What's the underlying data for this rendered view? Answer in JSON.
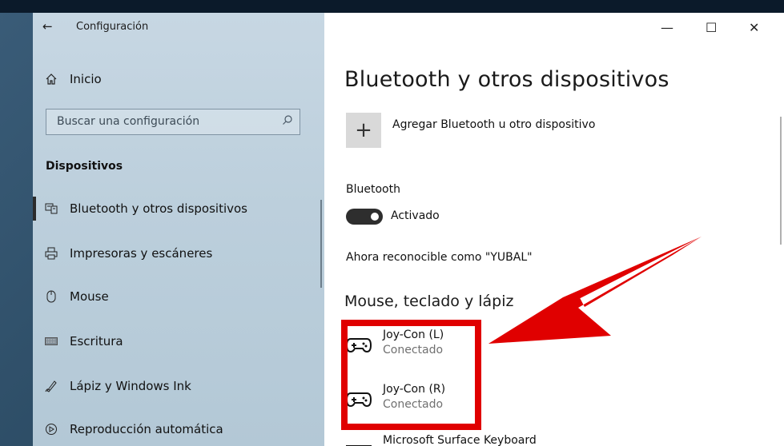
{
  "window": {
    "back_glyph": "←",
    "title": "Configuración",
    "controls": {
      "minimize": "—",
      "maximize": "☐",
      "close": "✕"
    }
  },
  "sidebar": {
    "home_label": "Inicio",
    "search_placeholder": "Buscar una configuración",
    "section_title": "Dispositivos",
    "items": [
      {
        "label": "Bluetooth y otros dispositivos",
        "icon": "bluetooth-devices-icon",
        "active": true
      },
      {
        "label": "Impresoras y escáneres",
        "icon": "printer-icon"
      },
      {
        "label": "Mouse",
        "icon": "mouse-icon"
      },
      {
        "label": "Escritura",
        "icon": "keyboard-icon"
      },
      {
        "label": "Lápiz y Windows Ink",
        "icon": "pen-icon"
      },
      {
        "label": "Reproducción automática",
        "icon": "autoplay-icon"
      }
    ]
  },
  "main": {
    "title": "Bluetooth y otros dispositivos",
    "add_button_label": "Agregar Bluetooth u otro dispositivo",
    "add_glyph": "+",
    "bluetooth_label": "Bluetooth",
    "toggle_state": "Activado",
    "discoverable_text": "Ahora reconocible como \"YUBAL\"",
    "section_heading": "Mouse, teclado y lápiz",
    "devices": [
      {
        "name": "Joy-Con (L)",
        "status": "Conectado",
        "icon": "gamepad-icon"
      },
      {
        "name": "Joy-Con (R)",
        "status": "Conectado",
        "icon": "gamepad-icon"
      },
      {
        "name": "Microsoft Surface Keyboard",
        "status": "",
        "icon": "keyboard-icon"
      }
    ]
  },
  "colors": {
    "highlight": "#e00000",
    "toggle_on": "#2e2e2e",
    "sidebar_bg": "#bfd1de"
  }
}
